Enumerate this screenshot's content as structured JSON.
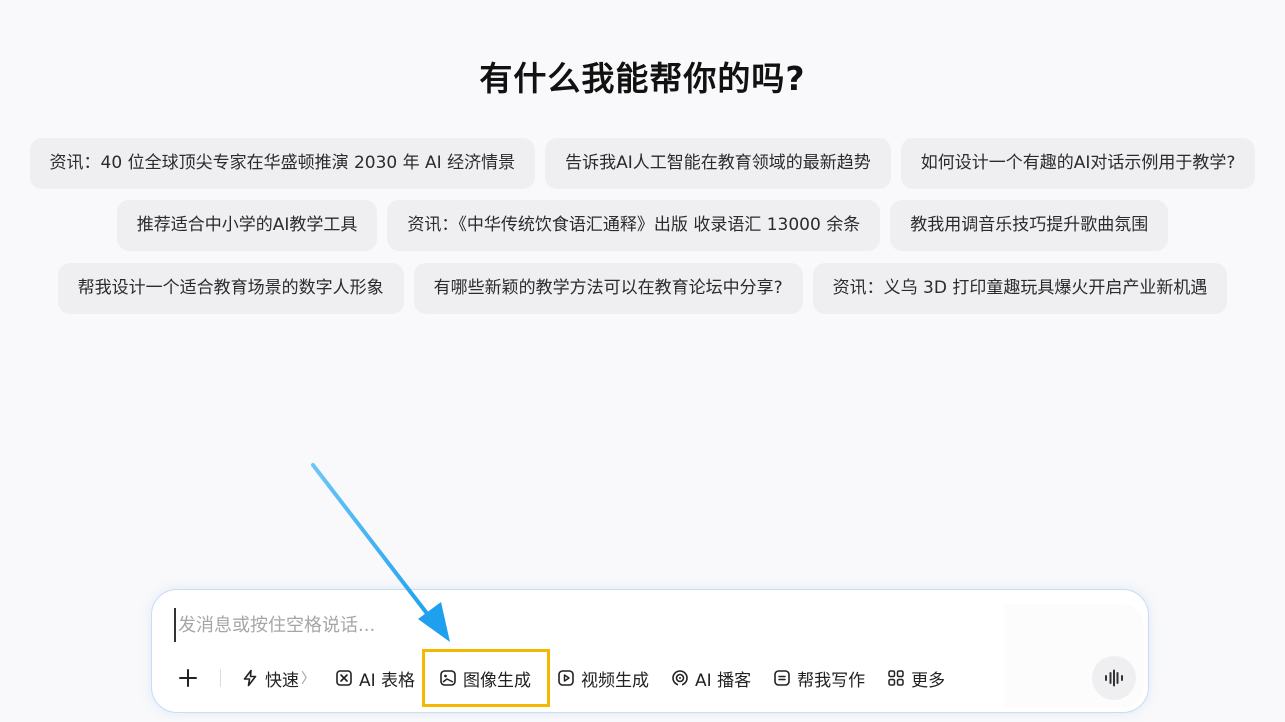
{
  "heading": "有什么我能帮你的吗?",
  "suggestions": {
    "row1": [
      "资讯：40 位全球顶尖专家在华盛顿推演 2030 年 AI 经济情景",
      "告诉我AI人工智能在教育领域的最新趋势",
      "如何设计一个有趣的AI对话示例用于教学?"
    ],
    "row2": [
      "推荐适合中小学的AI教学工具",
      "资讯：《中华传统饮食语汇通释》出版 收录语汇 13000 余条",
      "教我用调音乐技巧提升歌曲氛围"
    ],
    "row3": [
      "帮我设计一个适合教育场景的数字人形象",
      "有哪些新颖的教学方法可以在教育论坛中分享?",
      "资讯：义乌 3D 打印童趣玩具爆火开启产业新机遇"
    ]
  },
  "composer": {
    "placeholder": "发消息或按住空格说话...",
    "tools": {
      "fast": "快速",
      "fast_chevron": "〉",
      "ai_table": "AI 表格",
      "image_gen": "图像生成",
      "video_gen": "视频生成",
      "ai_podcast": "AI 播客",
      "help_write": "帮我写作",
      "more": "更多"
    }
  },
  "colors": {
    "highlight_box": "#f5b800",
    "arrow": "#29a8f0",
    "chip_bg": "#efeff1",
    "composer_border": "#c8dcf3"
  },
  "icons": {
    "plus": "plus-icon",
    "fast": "lightning-icon",
    "ai_table": "table-x-icon",
    "image_gen": "image-icon",
    "video_gen": "play-square-icon",
    "ai_podcast": "podcast-icon",
    "help_write": "note-icon",
    "more": "grid-icon",
    "voice": "voice-wave-icon"
  }
}
